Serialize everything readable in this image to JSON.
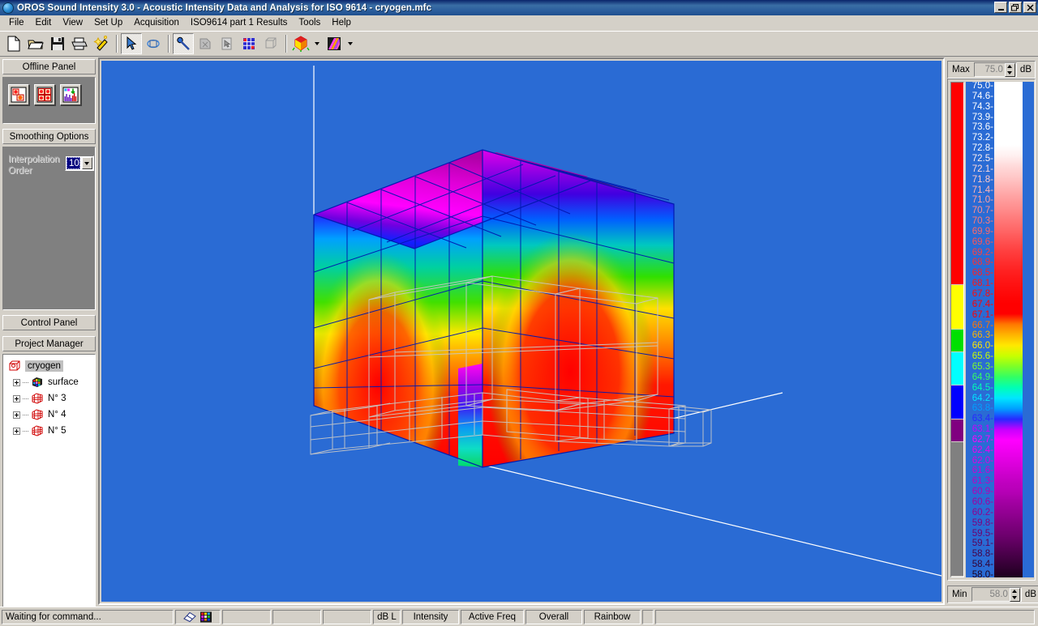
{
  "window": {
    "title": "OROS Sound Intensity 3.0 - Acoustic Intensity Data and Analysis for ISO 9614 - cryogen.mfc",
    "icon": "globe-icon",
    "minimize": "minimize-icon",
    "restore": "restore-icon",
    "close": "close-icon"
  },
  "menubar": {
    "items": [
      {
        "label": "File",
        "accel": "F"
      },
      {
        "label": "Edit",
        "accel": "E"
      },
      {
        "label": "View",
        "accel": "V"
      },
      {
        "label": "Set Up",
        "accel": "S"
      },
      {
        "label": "Acquisition",
        "accel": "A"
      },
      {
        "label": "ISO9614 part 1 Results",
        "accel": "I"
      },
      {
        "label": "Tools",
        "accel": "T"
      },
      {
        "label": "Help",
        "accel": "H"
      }
    ]
  },
  "toolbar": {
    "buttons": [
      {
        "name": "new-document-icon",
        "group": 1,
        "pressed": false
      },
      {
        "name": "open-folder-icon",
        "group": 1,
        "pressed": false
      },
      {
        "name": "save-disk-icon",
        "group": 1,
        "pressed": false
      },
      {
        "name": "print-icon",
        "group": 1,
        "pressed": false
      },
      {
        "name": "magic-wand-icon",
        "group": 1,
        "pressed": false
      },
      {
        "name": "select-arrow-icon",
        "group": 2,
        "pressed": true
      },
      {
        "name": "rotate-object-icon",
        "group": 2,
        "pressed": false
      },
      {
        "name": "pick-probe-icon",
        "group": 3,
        "pressed": true
      },
      {
        "name": "pan-hand-icon",
        "group": 3,
        "pressed": false
      },
      {
        "name": "select-face-icon",
        "group": 3,
        "pressed": false
      },
      {
        "name": "grid-mesh-icon",
        "group": 3,
        "pressed": false
      },
      {
        "name": "wireframe-cube-icon",
        "group": 3,
        "pressed": false
      },
      {
        "name": "colored-cube-icon",
        "group": 4,
        "pressed": false,
        "dropdown": true
      },
      {
        "name": "color-palette-icon",
        "group": 4,
        "pressed": false,
        "dropdown": true
      }
    ]
  },
  "offline_panel": {
    "title": "Offline Panel",
    "buttons": [
      {
        "name": "single-map-icon",
        "label": "Single Map"
      },
      {
        "name": "multi-map-icon",
        "label": "Multi Map"
      },
      {
        "name": "spectrum-chart-icon",
        "label": "Spectrum"
      }
    ]
  },
  "smoothing_options": {
    "title": "Smoothing Options",
    "interpolation_label_line1": "Interpolation",
    "interpolation_label_line2": "Order",
    "interpolation_value": "10",
    "dropdown_icon": "chevron-down-icon"
  },
  "control_panel": {
    "title": "Control Panel"
  },
  "project_manager": {
    "title": "Project Manager",
    "tree": [
      {
        "label": "cryogen",
        "icon": "wire-cube-icon",
        "selected": true,
        "expander": false,
        "depth": 0
      },
      {
        "label": "surface",
        "icon": "colored-mesh-icon",
        "selected": false,
        "expander": true,
        "depth": 1
      },
      {
        "label": "N° 3",
        "icon": "red-mesh-icon",
        "selected": false,
        "expander": true,
        "depth": 1
      },
      {
        "label": "N° 4",
        "icon": "red-mesh-icon",
        "selected": false,
        "expander": true,
        "depth": 1
      },
      {
        "label": "N° 5",
        "icon": "red-mesh-icon",
        "selected": false,
        "expander": true,
        "depth": 1
      }
    ]
  },
  "color_scale": {
    "max_label": "Max",
    "max_value": "75.0",
    "max_unit": "dB",
    "min_label": "Min",
    "min_value": "58.0",
    "min_unit": "dB",
    "up_arrow": "spinner-up-icon",
    "down_arrow": "spinner-down-icon",
    "discrete_bands": [
      {
        "color": "#ff0000",
        "weight": 18
      },
      {
        "color": "#ffff00",
        "weight": 4
      },
      {
        "color": "#00e000",
        "weight": 2
      },
      {
        "color": "#00ffff",
        "weight": 3
      },
      {
        "color": "#0000ff",
        "weight": 3
      },
      {
        "color": "#800080",
        "weight": 2
      },
      {
        "color": "#808080",
        "weight": 12
      }
    ],
    "ticks": [
      {
        "value": "75.0",
        "color": "#ffffff"
      },
      {
        "value": "74.6",
        "color": "#ffffff"
      },
      {
        "value": "74.3",
        "color": "#ffffff"
      },
      {
        "value": "73.9",
        "color": "#ffffff"
      },
      {
        "value": "73.6",
        "color": "#ffffff"
      },
      {
        "value": "73.2",
        "color": "#ffffff"
      },
      {
        "value": "72.8",
        "color": "#ffffff"
      },
      {
        "value": "72.5",
        "color": "#fff0f0"
      },
      {
        "value": "72.1",
        "color": "#ffdada"
      },
      {
        "value": "71.8",
        "color": "#ffc8c8"
      },
      {
        "value": "71.4",
        "color": "#ffb4b4"
      },
      {
        "value": "71.0",
        "color": "#ffa0a0"
      },
      {
        "value": "70.7",
        "color": "#ff8e8e"
      },
      {
        "value": "70.3",
        "color": "#ff7a7a"
      },
      {
        "value": "69.9",
        "color": "#ff6868"
      },
      {
        "value": "69.6",
        "color": "#ff5454"
      },
      {
        "value": "69.2",
        "color": "#ff4040"
      },
      {
        "value": "68.9",
        "color": "#ff3030"
      },
      {
        "value": "68.5",
        "color": "#ff2020"
      },
      {
        "value": "68.1",
        "color": "#ff1414"
      },
      {
        "value": "67.8",
        "color": "#ff0a0a"
      },
      {
        "value": "67.4",
        "color": "#ff0000"
      },
      {
        "value": "67.1",
        "color": "#ff0000"
      },
      {
        "value": "66.7",
        "color": "#ff7800"
      },
      {
        "value": "66.3",
        "color": "#ffb400"
      },
      {
        "value": "66.0",
        "color": "#ffe800"
      },
      {
        "value": "65.6",
        "color": "#c8ff00"
      },
      {
        "value": "65.3",
        "color": "#7cff28"
      },
      {
        "value": "64.9",
        "color": "#32ff64"
      },
      {
        "value": "64.5",
        "color": "#00ffb4"
      },
      {
        "value": "64.2",
        "color": "#00e6ff"
      },
      {
        "value": "63.8",
        "color": "#00a0ff"
      },
      {
        "value": "63.4",
        "color": "#2828ff"
      },
      {
        "value": "63.1",
        "color": "#c800ff"
      },
      {
        "value": "62.7",
        "color": "#ff00ff"
      },
      {
        "value": "62.4",
        "color": "#f000f0"
      },
      {
        "value": "62.0",
        "color": "#e000e0"
      },
      {
        "value": "61.6",
        "color": "#d000d0"
      },
      {
        "value": "61.3",
        "color": "#c000c0"
      },
      {
        "value": "60.9",
        "color": "#b400b4"
      },
      {
        "value": "60.6",
        "color": "#a000a0"
      },
      {
        "value": "60.2",
        "color": "#900090"
      },
      {
        "value": "59.8",
        "color": "#7e007e"
      },
      {
        "value": "59.5",
        "color": "#6e006e"
      },
      {
        "value": "59.1",
        "color": "#5a005a"
      },
      {
        "value": "58.8",
        "color": "#460046"
      },
      {
        "value": "58.4",
        "color": "#320032"
      },
      {
        "value": "58.0",
        "color": "#1e001e"
      }
    ]
  },
  "statusbar": {
    "message": "Waiting for command...",
    "icons": [
      "eraser-icon",
      "palette-grid-icon"
    ],
    "fields": [
      "",
      "",
      ""
    ],
    "units": "dB L",
    "quantity": "Intensity",
    "frequency": "Active Freq",
    "band": "Overall",
    "palette": "Rainbow",
    "trailing": ""
  },
  "viewport": {
    "background_color": "#2a6bd4",
    "mesh_line_color": "#0000a0",
    "wireframe_color": "#c0c0c0",
    "axis_color": "#ffffff",
    "description": "3D sound intensity map on a cubic measurement surface"
  }
}
